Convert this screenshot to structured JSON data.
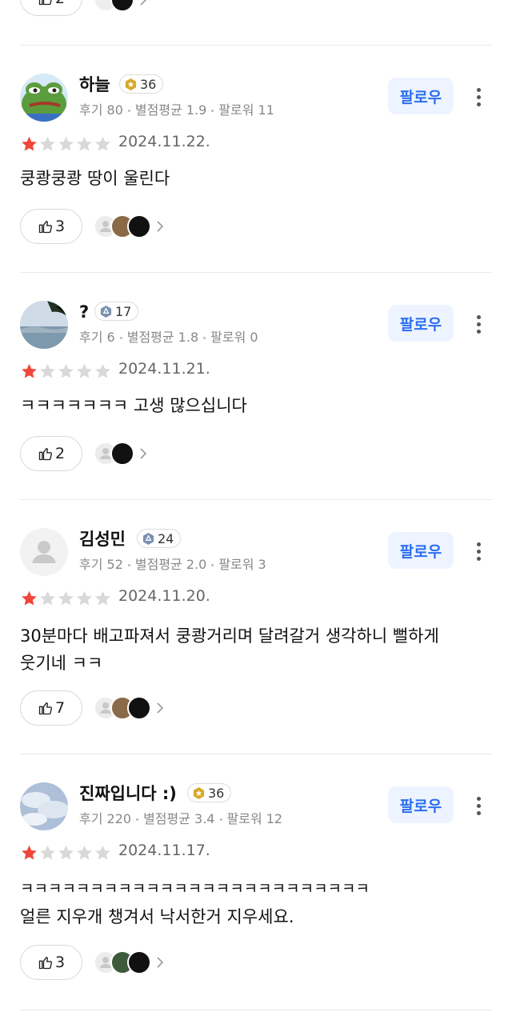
{
  "top_fragment": {
    "like_count": "2"
  },
  "actions": {
    "follow_label": "팔로우"
  },
  "reviews": [
    {
      "name": "하늘",
      "badge": {
        "type": "gold",
        "level": "36",
        "color": "#d8a82a"
      },
      "meta": {
        "reviews": "후기 80",
        "avg": "별점평균 1.9",
        "followers": "팔로워 11"
      },
      "rating": 1,
      "date": "2024.11.22.",
      "text_lines": [
        "쿵쾅쿵쾅 땅이 울린다"
      ],
      "likes": "3",
      "avatar_icon": "frog-avatar-icon"
    },
    {
      "name": "?",
      "badge": {
        "type": "silver",
        "level": "17",
        "color": "#7b8fb0"
      },
      "meta": {
        "reviews": "후기 6",
        "avg": "별점평균 1.8",
        "followers": "팔로워 0"
      },
      "rating": 1,
      "date": "2024.11.21.",
      "text_lines": [
        "ㅋㅋㅋㅋㅋㅋㅋ 고생 많으십니다"
      ],
      "likes": "2",
      "avatar_icon": "seaside-avatar-icon"
    },
    {
      "name": "김성민",
      "badge": {
        "type": "silver",
        "level": "24",
        "color": "#7b8fb0"
      },
      "meta": {
        "reviews": "후기 52",
        "avg": "별점평균 2.0",
        "followers": "팔로워 3"
      },
      "rating": 1,
      "date": "2024.11.20.",
      "text_lines": [
        "30분마다 배고파져서 쿵쾅거리며 달려갈거 생각하니 뻘하게",
        "웃기네 ㅋㅋ"
      ],
      "likes": "7",
      "avatar_icon": "default-user-icon"
    },
    {
      "name": "진짜입니다 :)",
      "badge": {
        "type": "gold",
        "level": "36",
        "color": "#d8a82a"
      },
      "meta": {
        "reviews": "후기 220",
        "avg": "별점평균 3.4",
        "followers": "팔로워 12"
      },
      "rating": 1,
      "date": "2024.11.17.",
      "text_lines": [
        "ㅋㅋㅋㅋㅋㅋㅋㅋㅋㅋㅋㅋㅋㅋㅋㅋㅋㅋㅋㅋㅋㅋㅋㅋㅋ",
        "얼른 지우개 챙겨서 낙서한거 지우세요."
      ],
      "likes": "3",
      "avatar_icon": "sky-avatar-icon"
    }
  ],
  "colors": {
    "star_on": "#f0463a",
    "star_off": "#d9d9d9",
    "follow_text": "#2b6ef2",
    "follow_bg": "#eef4ff"
  }
}
